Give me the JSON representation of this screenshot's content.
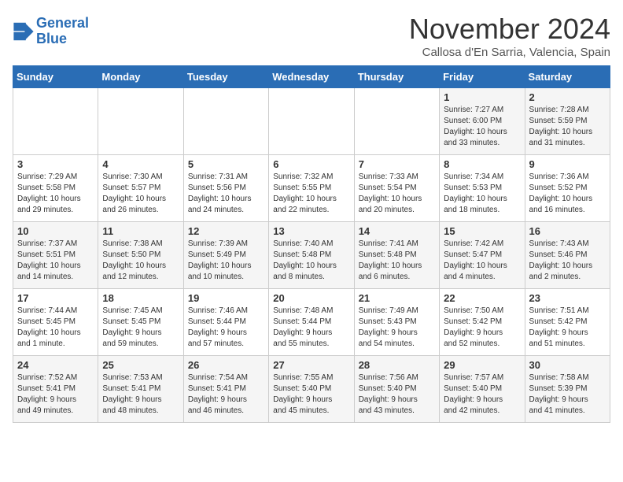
{
  "header": {
    "logo_line1": "General",
    "logo_line2": "Blue",
    "month": "November 2024",
    "location": "Callosa d'En Sarria, Valencia, Spain"
  },
  "weekdays": [
    "Sunday",
    "Monday",
    "Tuesday",
    "Wednesday",
    "Thursday",
    "Friday",
    "Saturday"
  ],
  "weeks": [
    [
      {
        "day": "",
        "info": ""
      },
      {
        "day": "",
        "info": ""
      },
      {
        "day": "",
        "info": ""
      },
      {
        "day": "",
        "info": ""
      },
      {
        "day": "",
        "info": ""
      },
      {
        "day": "1",
        "info": "Sunrise: 7:27 AM\nSunset: 6:00 PM\nDaylight: 10 hours\nand 33 minutes."
      },
      {
        "day": "2",
        "info": "Sunrise: 7:28 AM\nSunset: 5:59 PM\nDaylight: 10 hours\nand 31 minutes."
      }
    ],
    [
      {
        "day": "3",
        "info": "Sunrise: 7:29 AM\nSunset: 5:58 PM\nDaylight: 10 hours\nand 29 minutes."
      },
      {
        "day": "4",
        "info": "Sunrise: 7:30 AM\nSunset: 5:57 PM\nDaylight: 10 hours\nand 26 minutes."
      },
      {
        "day": "5",
        "info": "Sunrise: 7:31 AM\nSunset: 5:56 PM\nDaylight: 10 hours\nand 24 minutes."
      },
      {
        "day": "6",
        "info": "Sunrise: 7:32 AM\nSunset: 5:55 PM\nDaylight: 10 hours\nand 22 minutes."
      },
      {
        "day": "7",
        "info": "Sunrise: 7:33 AM\nSunset: 5:54 PM\nDaylight: 10 hours\nand 20 minutes."
      },
      {
        "day": "8",
        "info": "Sunrise: 7:34 AM\nSunset: 5:53 PM\nDaylight: 10 hours\nand 18 minutes."
      },
      {
        "day": "9",
        "info": "Sunrise: 7:36 AM\nSunset: 5:52 PM\nDaylight: 10 hours\nand 16 minutes."
      }
    ],
    [
      {
        "day": "10",
        "info": "Sunrise: 7:37 AM\nSunset: 5:51 PM\nDaylight: 10 hours\nand 14 minutes."
      },
      {
        "day": "11",
        "info": "Sunrise: 7:38 AM\nSunset: 5:50 PM\nDaylight: 10 hours\nand 12 minutes."
      },
      {
        "day": "12",
        "info": "Sunrise: 7:39 AM\nSunset: 5:49 PM\nDaylight: 10 hours\nand 10 minutes."
      },
      {
        "day": "13",
        "info": "Sunrise: 7:40 AM\nSunset: 5:48 PM\nDaylight: 10 hours\nand 8 minutes."
      },
      {
        "day": "14",
        "info": "Sunrise: 7:41 AM\nSunset: 5:48 PM\nDaylight: 10 hours\nand 6 minutes."
      },
      {
        "day": "15",
        "info": "Sunrise: 7:42 AM\nSunset: 5:47 PM\nDaylight: 10 hours\nand 4 minutes."
      },
      {
        "day": "16",
        "info": "Sunrise: 7:43 AM\nSunset: 5:46 PM\nDaylight: 10 hours\nand 2 minutes."
      }
    ],
    [
      {
        "day": "17",
        "info": "Sunrise: 7:44 AM\nSunset: 5:45 PM\nDaylight: 10 hours\nand 1 minute."
      },
      {
        "day": "18",
        "info": "Sunrise: 7:45 AM\nSunset: 5:45 PM\nDaylight: 9 hours\nand 59 minutes."
      },
      {
        "day": "19",
        "info": "Sunrise: 7:46 AM\nSunset: 5:44 PM\nDaylight: 9 hours\nand 57 minutes."
      },
      {
        "day": "20",
        "info": "Sunrise: 7:48 AM\nSunset: 5:44 PM\nDaylight: 9 hours\nand 55 minutes."
      },
      {
        "day": "21",
        "info": "Sunrise: 7:49 AM\nSunset: 5:43 PM\nDaylight: 9 hours\nand 54 minutes."
      },
      {
        "day": "22",
        "info": "Sunrise: 7:50 AM\nSunset: 5:42 PM\nDaylight: 9 hours\nand 52 minutes."
      },
      {
        "day": "23",
        "info": "Sunrise: 7:51 AM\nSunset: 5:42 PM\nDaylight: 9 hours\nand 51 minutes."
      }
    ],
    [
      {
        "day": "24",
        "info": "Sunrise: 7:52 AM\nSunset: 5:41 PM\nDaylight: 9 hours\nand 49 minutes."
      },
      {
        "day": "25",
        "info": "Sunrise: 7:53 AM\nSunset: 5:41 PM\nDaylight: 9 hours\nand 48 minutes."
      },
      {
        "day": "26",
        "info": "Sunrise: 7:54 AM\nSunset: 5:41 PM\nDaylight: 9 hours\nand 46 minutes."
      },
      {
        "day": "27",
        "info": "Sunrise: 7:55 AM\nSunset: 5:40 PM\nDaylight: 9 hours\nand 45 minutes."
      },
      {
        "day": "28",
        "info": "Sunrise: 7:56 AM\nSunset: 5:40 PM\nDaylight: 9 hours\nand 43 minutes."
      },
      {
        "day": "29",
        "info": "Sunrise: 7:57 AM\nSunset: 5:40 PM\nDaylight: 9 hours\nand 42 minutes."
      },
      {
        "day": "30",
        "info": "Sunrise: 7:58 AM\nSunset: 5:39 PM\nDaylight: 9 hours\nand 41 minutes."
      }
    ]
  ]
}
